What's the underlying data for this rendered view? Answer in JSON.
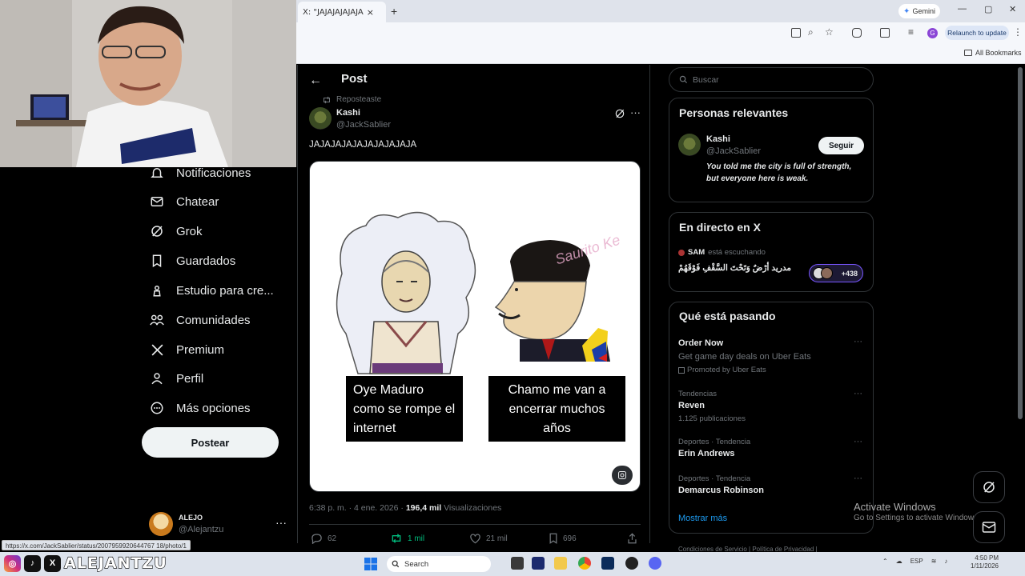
{
  "browser": {
    "tab_title": "X: \"JAJAJAJAJAJA",
    "tab_close": "×",
    "new_tab": "+",
    "gemini_label": "Gemini",
    "relaunch_label": "Relaunch to update",
    "profile_initial": "G",
    "bookmarks_label": "All Bookmarks",
    "status_url": "https://x.com/JackSablier/status/2007959920644767 18/photo/1"
  },
  "nav": {
    "items": [
      {
        "label": "Notificaciones",
        "icon": "bell-icon"
      },
      {
        "label": "Chatear",
        "icon": "mail-icon"
      },
      {
        "label": "Grok",
        "icon": "grok-icon"
      },
      {
        "label": "Guardados",
        "icon": "bookmark-icon"
      },
      {
        "label": "Estudio para cre...",
        "icon": "studio-icon"
      },
      {
        "label": "Comunidades",
        "icon": "communities-icon"
      },
      {
        "label": "Premium",
        "icon": "x-logo-icon"
      },
      {
        "label": "Perfil",
        "icon": "profile-icon"
      },
      {
        "label": "Más opciones",
        "icon": "more-circle-icon"
      }
    ],
    "post_button": "Postear",
    "account": {
      "name": "ALEJO",
      "handle": "@Alejantzu"
    }
  },
  "post": {
    "header_title": "Post",
    "repost_label": "Reposteaste",
    "author_name": "Kashi",
    "author_handle": "@JackSablier",
    "text": "JAJAJAJAJAJAJAJAJAJA",
    "meme": {
      "caption_left": "Oye Maduro como se rompe el internet",
      "caption_right": "Chamo me van a encerrar muchos años",
      "watermark": "Saurito Ke"
    },
    "meta_time": "6:38 p. m. · 4 ene. 2026 · ",
    "meta_views_count": "196,4 mil",
    "meta_views_label": " Visualizaciones",
    "actions": {
      "replies": "62",
      "reposts": "1 mil",
      "likes": "21 mil",
      "bookmarks": "696"
    }
  },
  "sidebar": {
    "search_placeholder": "Buscar",
    "relevant": {
      "title": "Personas relevantes",
      "name": "Kashi",
      "handle": "@JackSablier",
      "bio": "You told me the city is full of strength, but everyone here is weak.",
      "follow": "Seguir"
    },
    "live": {
      "title": "En directo en X",
      "host": "SAM",
      "host_suffix": "está escuchando",
      "space_title": "مدريد أرْضٌ وَتَحْتَ السَّقْفِ فَوْقَهُمْ",
      "listeners": "+438"
    },
    "trends": {
      "title": "Qué está pasando",
      "items": [
        {
          "name": "Order Now",
          "desc": "Get game day deals on Uber Eats",
          "promo": "Promoted by Uber Eats"
        },
        {
          "meta": "Tendencias",
          "name": "Reven",
          "count": "1.125 publicaciones"
        },
        {
          "meta": "Deportes · Tendencia",
          "name": "Erin Andrews"
        },
        {
          "meta": "Deportes · Tendencia",
          "name": "Demarcus Robinson"
        }
      ],
      "show_more": "Mostrar más"
    },
    "footer": "Condiciones de Servicio  |  Política de Privacidad  |"
  },
  "windows": {
    "activate_title": "Activate Windows",
    "activate_sub": "Go to Settings to activate Windows.",
    "search_label": "Search",
    "lang": "ESP",
    "time": "4:50 PM",
    "date": "1/11/2026"
  },
  "overlay": {
    "brand_name": "ALEJANTZU"
  },
  "colors": {
    "accent": "#1d9bf0",
    "repost_green": "#00ba7c",
    "live_purple": "#7856ff",
    "bg": "#000000",
    "text": "#e7e9ea",
    "muted": "#71767b"
  }
}
